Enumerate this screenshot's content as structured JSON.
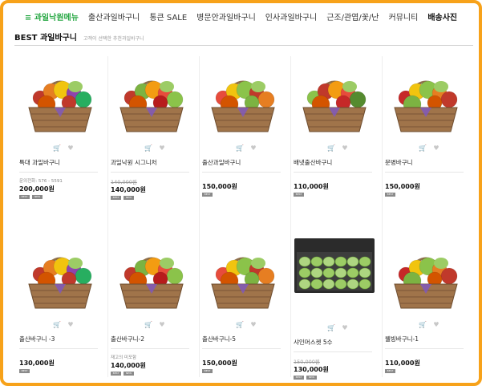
{
  "nav": {
    "items": [
      "≡ 과일낙원메뉴",
      "출산과일바구니",
      "통큰 SALE",
      "병문안과일바구니",
      "인사과일바구니",
      "근조/관엽/꽃/난",
      "커뮤니티",
      "배송사진"
    ]
  },
  "section": {
    "title": "BEST 과일바구니",
    "subtitle": "고객이 선택한 추천과일바구니"
  },
  "icons": {
    "cart": "cart-icon",
    "heart": "heart-icon"
  },
  "colors": {
    "frame": "#f7a21a",
    "menu": "#27a844"
  },
  "products": [
    {
      "name": "특대 과일바구니",
      "extra": "문의전화: 576 - 5591",
      "old_price": "",
      "price": "200,000원",
      "badges": [
        "BEST",
        "NEW"
      ]
    },
    {
      "name": "과일낙원 시그니처",
      "extra": "",
      "old_price": "140,000원",
      "price": "140,000원",
      "badges": [
        "BEST",
        "NEW"
      ]
    },
    {
      "name": "출산과일바구니",
      "extra": "",
      "old_price": "",
      "price": "150,000원",
      "badges": [
        "BEST"
      ]
    },
    {
      "name": "배냇출산바구니",
      "extra": "",
      "old_price": "",
      "price": "110,000원",
      "badges": [
        "BEST"
      ]
    },
    {
      "name": "문병바구니",
      "extra": "",
      "old_price": "",
      "price": "150,000원",
      "badges": [
        "BEST"
      ]
    },
    {
      "name": "출산바구니 -3",
      "extra": "",
      "old_price": "",
      "price": "130,000원",
      "badges": [
        "BEST"
      ]
    },
    {
      "name": "출산바구니-2",
      "extra": "재고의 미포함",
      "old_price": "",
      "price": "140,000원",
      "badges": [
        "BEST",
        "NEW"
      ]
    },
    {
      "name": "출산바구니-5",
      "extra": "",
      "old_price": "",
      "price": "150,000원",
      "badges": [
        "BEST"
      ]
    },
    {
      "name": "샤인머스켓 5수",
      "extra": "",
      "old_price": "150,000원",
      "price": "130,000원",
      "badges": [
        "BEST",
        "NEW"
      ]
    },
    {
      "name": "웰빙바구니-1",
      "extra": "",
      "old_price": "",
      "price": "110,000원",
      "badges": [
        "BEST"
      ]
    }
  ]
}
